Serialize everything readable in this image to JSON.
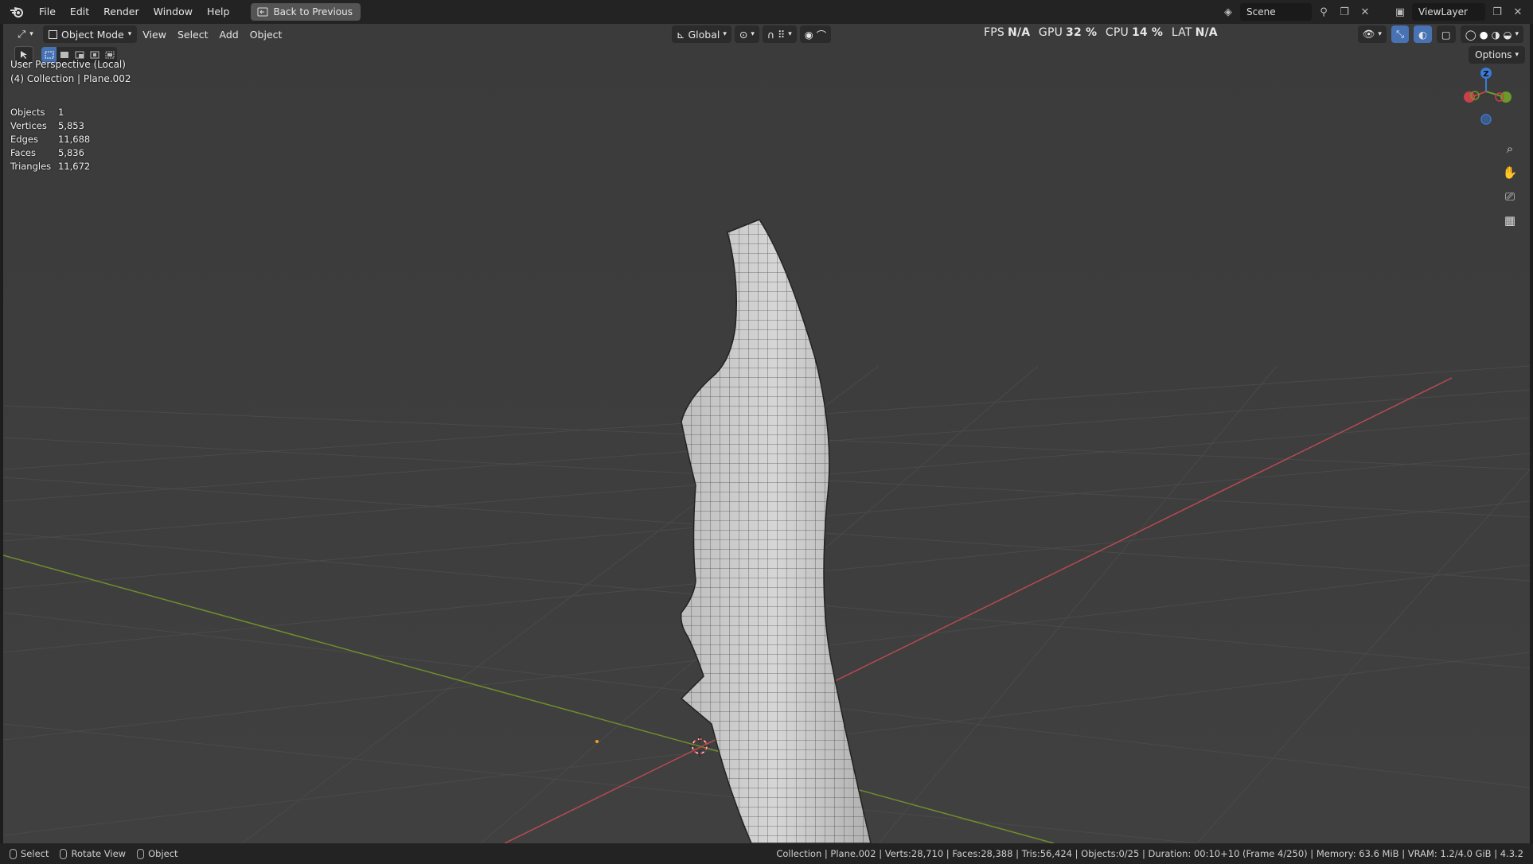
{
  "topbar": {
    "menus": [
      "File",
      "Edit",
      "Render",
      "Window",
      "Help"
    ],
    "back_button": "Back to Previous",
    "scene": "Scene",
    "view_layer": "ViewLayer"
  },
  "viewport_header": {
    "mode": "Object Mode",
    "menus": [
      "View",
      "Select",
      "Add",
      "Object"
    ],
    "transform_orientation": "Global",
    "perf": {
      "fps_label": "FPS",
      "fps_value": "N/A",
      "gpu_label": "GPU",
      "gpu_value": "32 %",
      "cpu_label": "CPU",
      "cpu_value": "14 %",
      "lat_label": "LAT",
      "lat_value": "N/A"
    },
    "options": "Options"
  },
  "overlay": {
    "view_name": "User Perspective (Local)",
    "collection_line": "(4) Collection | Plane.002",
    "stats": [
      {
        "label": "Objects",
        "value": "1"
      },
      {
        "label": "Vertices",
        "value": "5,853"
      },
      {
        "label": "Edges",
        "value": "11,688"
      },
      {
        "label": "Faces",
        "value": "5,836"
      },
      {
        "label": "Triangles",
        "value": "11,672"
      }
    ]
  },
  "gizmo": {
    "z_label": "Z"
  },
  "statusbar": {
    "hints": [
      "Select",
      "Rotate View",
      "Object"
    ],
    "info": "Collection | Plane.002 | Verts:28,710 | Faces:28,388 | Tris:56,424 | Objects:0/25 | Duration: 00:10+10 (Frame 4/250) | Memory: 63.6 MiB | VRAM: 1.2/4.0 GiB | 4.3.2"
  },
  "colors": {
    "accent": "#4772b3",
    "x_axis": "#b84a52",
    "y_axis": "#6e8f2c",
    "viewport_bg": "#3d3d3d"
  }
}
